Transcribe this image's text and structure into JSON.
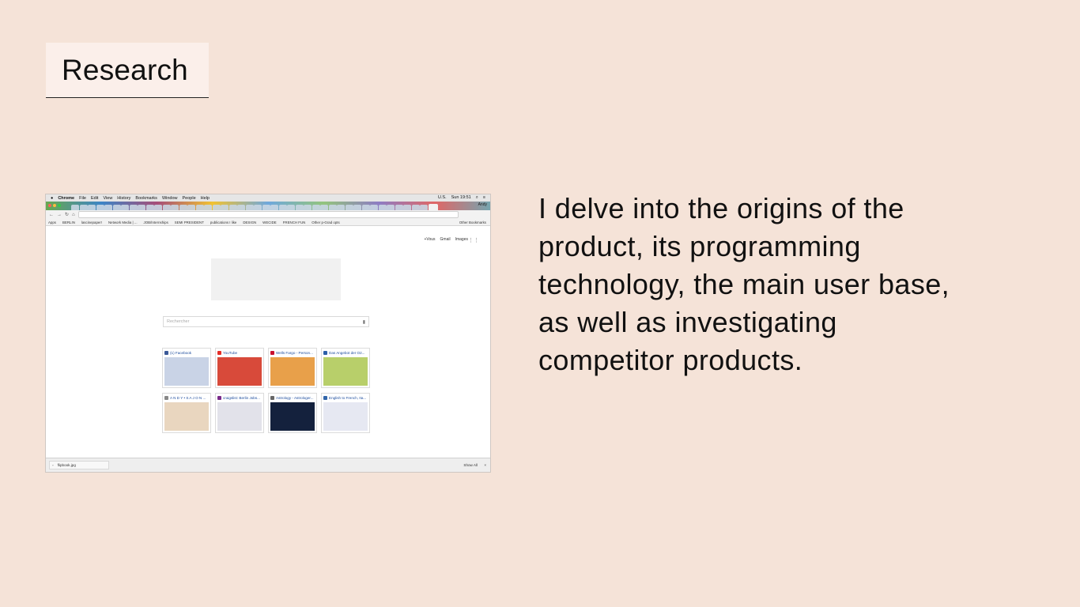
{
  "slide": {
    "title": "Research",
    "body": "I delve into the origins of the product, its programming technology, the main user base, as well as investigating competitor products."
  },
  "colors": {
    "background": "#f5e3d8",
    "title_box": "#fbefea",
    "text": "#111111"
  },
  "screenshot": {
    "menubar": {
      "apple": "",
      "app": "Chrome",
      "items": [
        "File",
        "Edit",
        "View",
        "History",
        "Bookmarks",
        "Window",
        "People",
        "Help"
      ],
      "clock": "Sun 19:51",
      "locale": "U.S."
    },
    "profile_name": "Andy",
    "bookmarks": [
      "Apps",
      "BERLIN",
      "lascinepaper!",
      "Network Media | ...",
      "JOB/Internships",
      "SEMI PRESIDENT",
      "publications I like",
      "DESIGN",
      "WECIDE",
      "FRENCH FUN",
      "Other p-Grad opts",
      "Other Bookmarks"
    ],
    "google_links": [
      "+Vous",
      "Gmail",
      "Images"
    ],
    "search_placeholder": "Rechercher",
    "tiles": [
      {
        "label": "(1) Facebook",
        "fav": "#3b5998",
        "thumb": "#c9d3e6"
      },
      {
        "label": "YouTube",
        "fav": "#e52d27",
        "thumb": "#d84a3a"
      },
      {
        "label": "Wells Fargo - Person...",
        "fav": "#c8102e",
        "thumb": "#e8a04a"
      },
      {
        "label": "Das Angebot der O2...",
        "fav": "#2c5fa8",
        "thumb": "#b8cf6a"
      },
      {
        "label": "A N D Y • S A J O N ...",
        "fav": "#888888",
        "thumb": "#e9d6bf"
      },
      {
        "label": "craigslist: Berlin Jobs...",
        "fav": "#7a2a8a",
        "thumb": "#e2e2ea"
      },
      {
        "label": "Astrology - Astrologer...",
        "fav": "#666666",
        "thumb": "#14213d"
      },
      {
        "label": "English to French, Ita...",
        "fav": "#3366aa",
        "thumb": "#e6e8f2"
      }
    ],
    "download": {
      "file": "flipbook.jpg",
      "show_all": "Show All"
    }
  }
}
